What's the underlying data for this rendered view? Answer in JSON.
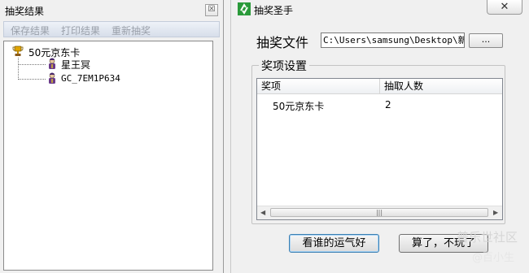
{
  "left_window": {
    "title": "抽奖结果",
    "close_glyph": "☒",
    "toolbar": [
      "保存结果",
      "打印结果",
      "重新抽奖"
    ],
    "tree": {
      "root_label": "50元京东卡",
      "children": [
        "星王冥",
        "GC_7EM1P634"
      ]
    }
  },
  "right_window": {
    "title": "抽奖圣手",
    "close_glyph": "✕",
    "file": {
      "label": "抽奖文件",
      "value": "C:\\Users\\samsung\\Desktop\\新建",
      "browse_label": "..."
    },
    "group_title": "奖项设置",
    "table": {
      "columns": [
        "奖项",
        "抽取人数"
      ],
      "rows": [
        [
          "50元京东卡",
          "2"
        ]
      ]
    },
    "buttons": {
      "draw": "看谁的运气好",
      "quit": "算了，不玩了"
    }
  },
  "watermark": {
    "line1": "普乐世社区",
    "line2": "@百小生"
  }
}
